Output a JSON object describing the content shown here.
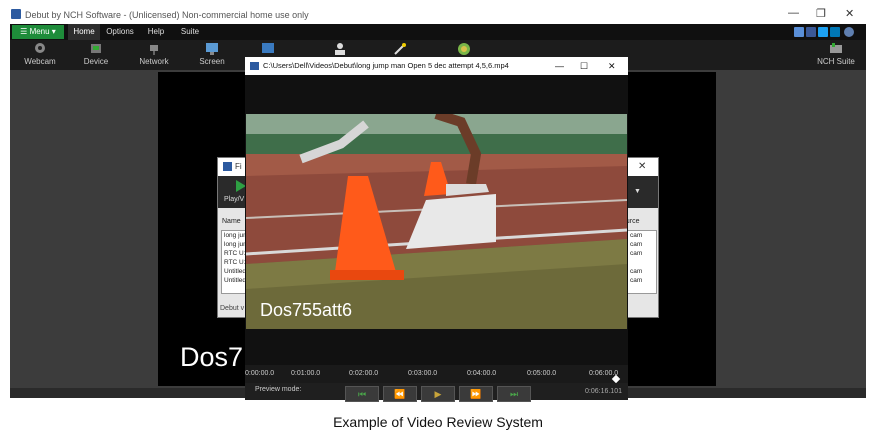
{
  "window": {
    "title": "Debut by NCH Software - (Unlicensed) Non-commercial home use only",
    "controls": [
      "—",
      "❐",
      "✕"
    ]
  },
  "menubar": {
    "menu_label": "☰ Menu ▾",
    "tabs": [
      "Home",
      "Options",
      "Help",
      "Suite"
    ]
  },
  "toolbar": {
    "webcam": "Webcam",
    "device": "Device",
    "network": "Network",
    "screen": "Screen",
    "nch_suite": "NCH Suite"
  },
  "background_dialog": {
    "title_fragment": "Fi",
    "play_label": "Play/V",
    "col_name": "Name",
    "col_source": "ource",
    "rows": [
      "long jum",
      "long jum",
      "RTC U1",
      "RTC U1",
      "Untitled",
      "Untitled"
    ],
    "source_rows": [
      "cam",
      "cam",
      "cam",
      "cam",
      "cam"
    ],
    "footer": "Debut v"
  },
  "preview": {
    "overlay_text": "Dos7"
  },
  "player": {
    "title": "C:\\Users\\Dell\\Videos\\Debut\\long jump man Open 5 dec attempt 4,5,6.mp4",
    "controls": [
      "—",
      "☐",
      "✕"
    ],
    "overlay_text": "Dos755att6",
    "timeline_ticks": [
      "0:00:00.0",
      "0:01:00.0",
      "0:02:00.0",
      "0:03:00.0",
      "0:04:00.0",
      "0:05:00.0",
      "0:06:00.0"
    ],
    "preview_mode_label": "Preview mode:",
    "time_fragment": "0:06:16.101",
    "buttons": [
      "⏮",
      "⏪",
      "▶",
      "⏩",
      "⏭"
    ]
  },
  "caption": "Example of Video Review System"
}
